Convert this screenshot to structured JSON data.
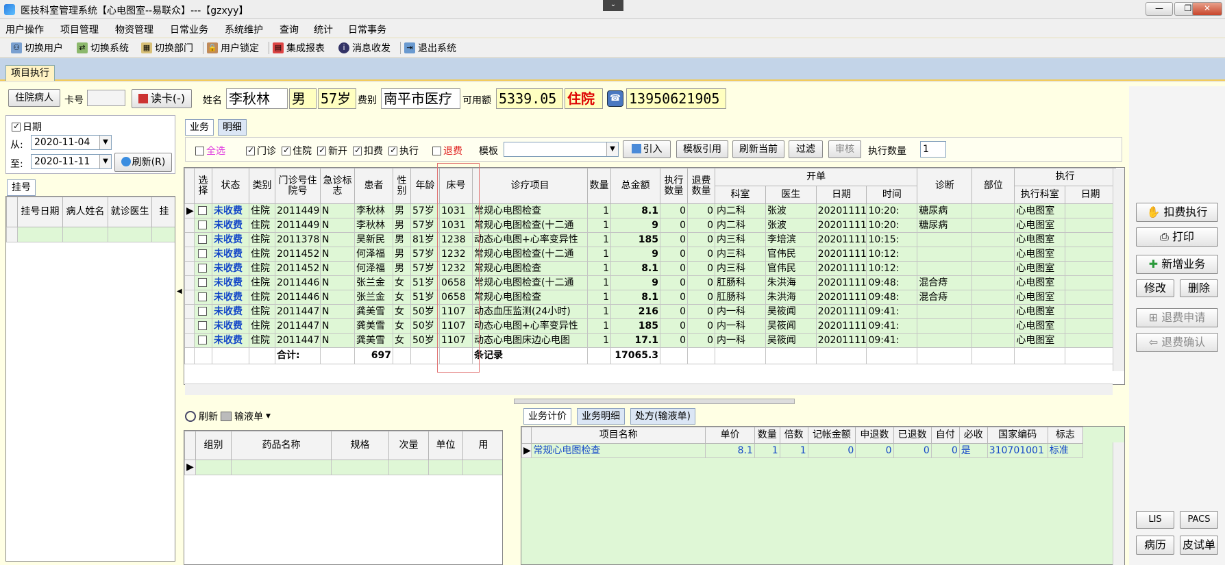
{
  "window": {
    "title": "医技科室管理系统【心电图室--易联众】---【gzxyy】",
    "grip": "⌄"
  },
  "menu": [
    "用户操作",
    "项目管理",
    "物资管理",
    "日常业务",
    "系统维护",
    "查询",
    "统计",
    "日常事务"
  ],
  "toolbar": [
    {
      "label": "切换用户",
      "icon": "users-icon"
    },
    {
      "label": "切换系统",
      "icon": "switch-icon"
    },
    {
      "label": "切换部门",
      "icon": "dept-icon"
    },
    {
      "label": "用户锁定",
      "icon": "lock-icon"
    },
    {
      "label": "集成报表",
      "icon": "report-icon"
    },
    {
      "label": "消息收发",
      "icon": "info-icon"
    },
    {
      "label": "退出系统",
      "icon": "exit-icon"
    }
  ],
  "tab": "项目执行",
  "patient": {
    "type_btn": "住院病人",
    "card_label": "卡号",
    "card_value": "",
    "read_card": "读卡(-)",
    "name_label": "姓名",
    "name": "李秋林",
    "sex": "男",
    "age": "57岁",
    "fee_label": "费别",
    "fee": "南平市医疗",
    "balance_label": "可用额",
    "balance": "5339.05",
    "status": "住院",
    "phone": "13950621905"
  },
  "left": {
    "date_label": "日期",
    "from_label": "从:",
    "from": "2020-11-04",
    "to_label": "至:",
    "to": "2020-11-11",
    "refresh": "刷新(R)",
    "reg_tab": "挂号",
    "reg_cols": [
      "挂号日期",
      "病人姓名",
      "就诊医生",
      "挂"
    ]
  },
  "subtabs": [
    "业务",
    "明细"
  ],
  "opbar": {
    "all": "全选",
    "outpatient": "门诊",
    "inpatient": "住院",
    "newopen": "新开",
    "charged": "扣费",
    "executed": "执行",
    "refund": "退费",
    "template_label": "模板",
    "import": "引入",
    "template_ref": "模板引用",
    "refresh_cur": "刷新当前",
    "filter": "过滤",
    "review": "审核",
    "exec_qty_label": "执行数量",
    "exec_qty": "1"
  },
  "main_grid": {
    "headers": {
      "select": "选择",
      "status": "状态",
      "category": "类别",
      "no": "门诊号住院号",
      "urgent": "急诊标志",
      "patient": "患者",
      "sex": "性别",
      "age": "年龄",
      "bed": "床号",
      "item": "诊疗项目",
      "qty": "数量",
      "total": "总金额",
      "exec_qty": "执行数量",
      "ref_qty": "退费数量",
      "open": "开单",
      "open_dept": "科室",
      "open_doc": "医生",
      "open_date": "日期",
      "open_time": "时间",
      "diag": "诊断",
      "part": "部位",
      "exec": "执行",
      "exec_dept": "执行科室",
      "exec_date": "日期"
    },
    "rows": [
      [
        "未收费",
        "住院",
        "2011449",
        "N",
        "李秋林",
        "男",
        "57岁",
        "1031",
        "常规心电图检查",
        "1",
        "8.1",
        "0",
        "0",
        "内二科",
        "张波",
        "20201111",
        "10:20:",
        "糖尿病",
        "",
        "心电图室",
        ""
      ],
      [
        "未收费",
        "住院",
        "2011449",
        "N",
        "李秋林",
        "男",
        "57岁",
        "1031",
        "常规心电图检查(十二通",
        "1",
        "9",
        "0",
        "0",
        "内二科",
        "张波",
        "20201111",
        "10:20:",
        "糖尿病",
        "",
        "心电图室",
        ""
      ],
      [
        "未收费",
        "住院",
        "2011378",
        "N",
        "吴新民",
        "男",
        "81岁",
        "1238",
        "动态心电图+心率变异性",
        "1",
        "185",
        "0",
        "0",
        "内三科",
        "李培滨",
        "20201111",
        "10:15:",
        "",
        "",
        "心电图室",
        ""
      ],
      [
        "未收费",
        "住院",
        "2011452",
        "N",
        "何泽福",
        "男",
        "57岁",
        "1232",
        "常规心电图检查(十二通",
        "1",
        "9",
        "0",
        "0",
        "内三科",
        "官伟民",
        "20201111",
        "10:12:",
        "",
        "",
        "心电图室",
        ""
      ],
      [
        "未收费",
        "住院",
        "2011452",
        "N",
        "何泽福",
        "男",
        "57岁",
        "1232",
        "常规心电图检查",
        "1",
        "8.1",
        "0",
        "0",
        "内三科",
        "官伟民",
        "20201111",
        "10:12:",
        "",
        "",
        "心电图室",
        ""
      ],
      [
        "未收费",
        "住院",
        "2011446",
        "N",
        "张兰金",
        "女",
        "51岁",
        "0658",
        "常规心电图检查(十二通",
        "1",
        "9",
        "0",
        "0",
        "肛肠科",
        "朱洪海",
        "20201111",
        "09:48:",
        "混合痔",
        "",
        "心电图室",
        ""
      ],
      [
        "未收费",
        "住院",
        "2011446",
        "N",
        "张兰金",
        "女",
        "51岁",
        "0658",
        "常规心电图检查",
        "1",
        "8.1",
        "0",
        "0",
        "肛肠科",
        "朱洪海",
        "20201111",
        "09:48:",
        "混合痔",
        "",
        "心电图室",
        ""
      ],
      [
        "未收费",
        "住院",
        "2011447",
        "N",
        "龚美雪",
        "女",
        "50岁",
        "1107",
        "动态血压监测(24小时)",
        "1",
        "216",
        "0",
        "0",
        "内一科",
        "吴筱闻",
        "20201111",
        "09:41:",
        "",
        "",
        "心电图室",
        ""
      ],
      [
        "未收费",
        "住院",
        "2011447",
        "N",
        "龚美雪",
        "女",
        "50岁",
        "1107",
        "动态心电图+心率变异性",
        "1",
        "185",
        "0",
        "0",
        "内一科",
        "吴筱闻",
        "20201111",
        "09:41:",
        "",
        "",
        "心电图室",
        ""
      ],
      [
        "未收费",
        "住院",
        "2011447",
        "N",
        "龚美雪",
        "女",
        "50岁",
        "1107",
        "动态心电图床边心电图",
        "1",
        "17.1",
        "0",
        "0",
        "内一科",
        "吴筱闻",
        "20201111",
        "09:41:",
        "",
        "",
        "心电图室",
        ""
      ]
    ],
    "summary": {
      "label": "合计:",
      "count": "697",
      "records": "条记录",
      "total": "17065.3"
    }
  },
  "drug": {
    "refresh": "刷新",
    "infusion": "输液单",
    "cols": [
      "组别",
      "药品名称",
      "规格",
      "次量",
      "单位",
      "用"
    ]
  },
  "bottom_tabs": [
    "业务计价",
    "业务明细",
    "处方(输液单)"
  ],
  "price_grid": {
    "cols": [
      "项目名称",
      "单价",
      "数量",
      "倍数",
      "记帐金额",
      "申退数",
      "已退数",
      "自付",
      "必收",
      "国家编码",
      "标志"
    ],
    "rows": [
      [
        "常规心电图检查",
        "8.1",
        "1",
        "1",
        "0",
        "0",
        "0",
        "0",
        "是",
        "310701001",
        "标准"
      ]
    ]
  },
  "right": {
    "deduct": "扣费执行",
    "print": "打印",
    "add": "新增业务",
    "edit": "修改",
    "delete": "删除",
    "refund_apply": "退费申请",
    "refund_confirm": "退费确认",
    "lis": "LIS",
    "pacs": "PACS",
    "history": "病历",
    "skin": "皮试单"
  },
  "colors": {
    "row_bg": "#dff7d6",
    "status_blue": "#1346c8",
    "patient_field": "#ffffc0"
  }
}
